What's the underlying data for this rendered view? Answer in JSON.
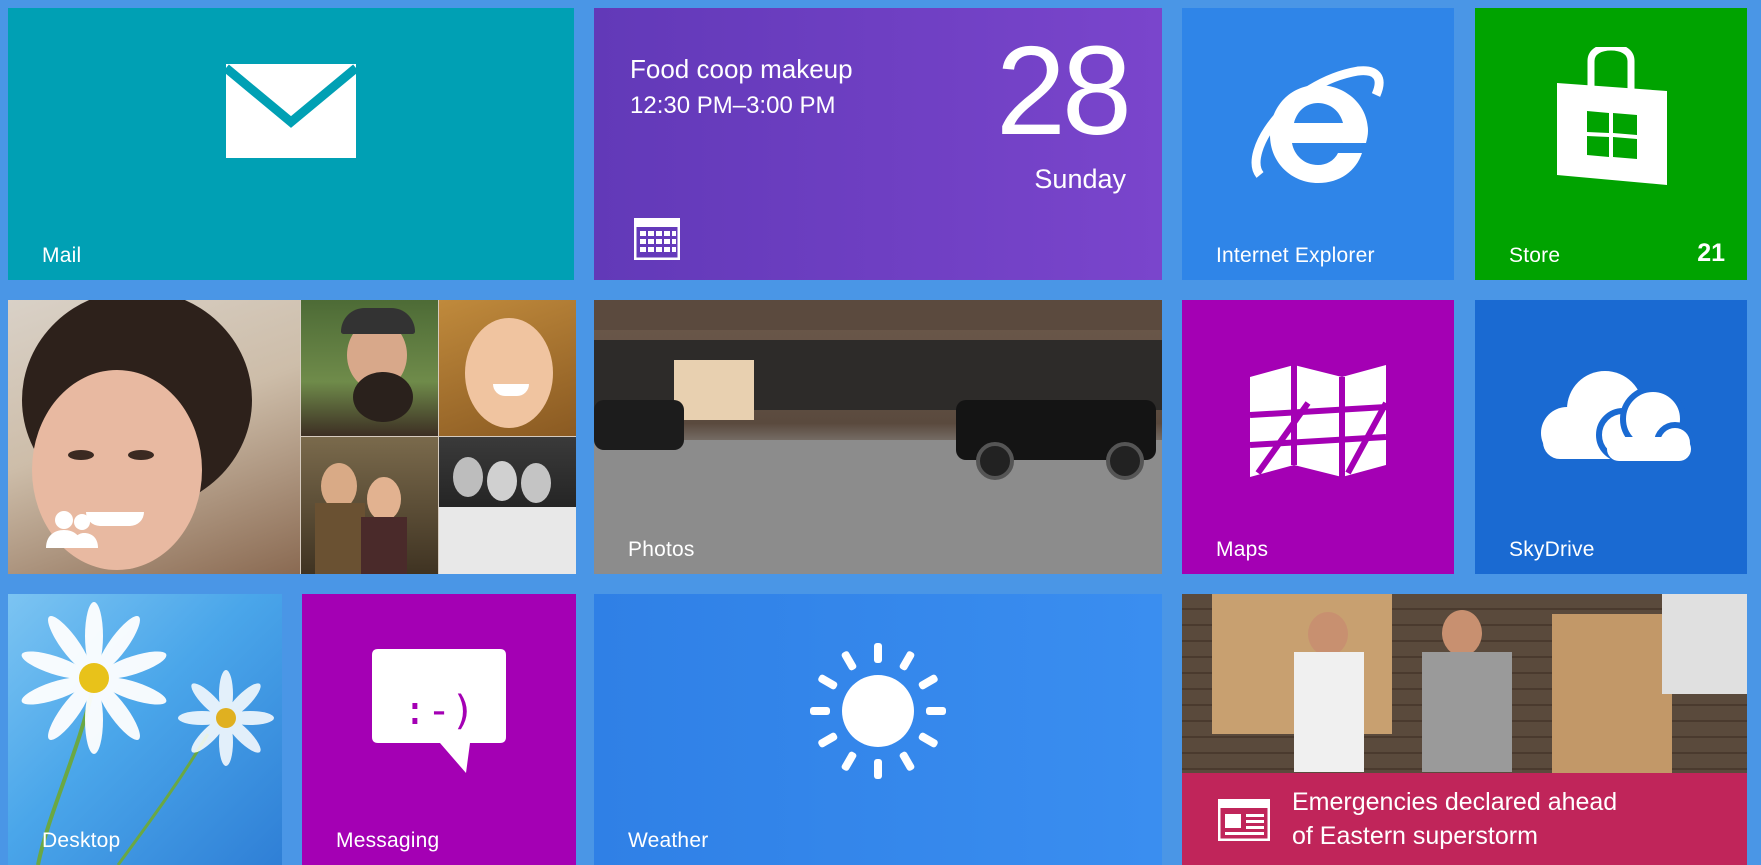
{
  "tiles": {
    "mail": {
      "label": "Mail",
      "color": "#00a0b4",
      "icon": "mail-envelope-icon"
    },
    "calendar": {
      "color": "#6b3ec0",
      "event_title": "Food coop makeup",
      "event_time": "12:30 PM–3:00 PM",
      "day_number": "28",
      "day_name": "Sunday",
      "icon": "calendar-grid-icon"
    },
    "internet_explorer": {
      "label": "Internet Explorer",
      "color": "#2f85e8",
      "icon": "ie-logo-icon"
    },
    "store": {
      "label": "Store",
      "badge": "21",
      "color": "#00a300",
      "icon": "store-bag-icon"
    },
    "people": {
      "color": "#d6cbbf",
      "icon": "people-icon"
    },
    "photos": {
      "label": "Photos",
      "color": "#7a7a7a"
    },
    "maps": {
      "label": "Maps",
      "color": "#a400b4",
      "icon": "map-icon"
    },
    "skydrive": {
      "label": "SkyDrive",
      "color": "#1a6ad2",
      "icon": "cloud-icon"
    },
    "desktop": {
      "label": "Desktop",
      "color": "#4aa6ea"
    },
    "messaging": {
      "label": "Messaging",
      "color": "#a400b4",
      "icon": "chat-bubble-icon",
      "emoticon": ":-)"
    },
    "weather": {
      "label": "Weather",
      "color": "#2f85e8",
      "icon": "sun-icon"
    },
    "news": {
      "color": "#c0255a",
      "headline_line1": "Emergencies declared ahead",
      "headline_line2": "of Eastern superstorm",
      "icon": "newspaper-icon"
    }
  }
}
